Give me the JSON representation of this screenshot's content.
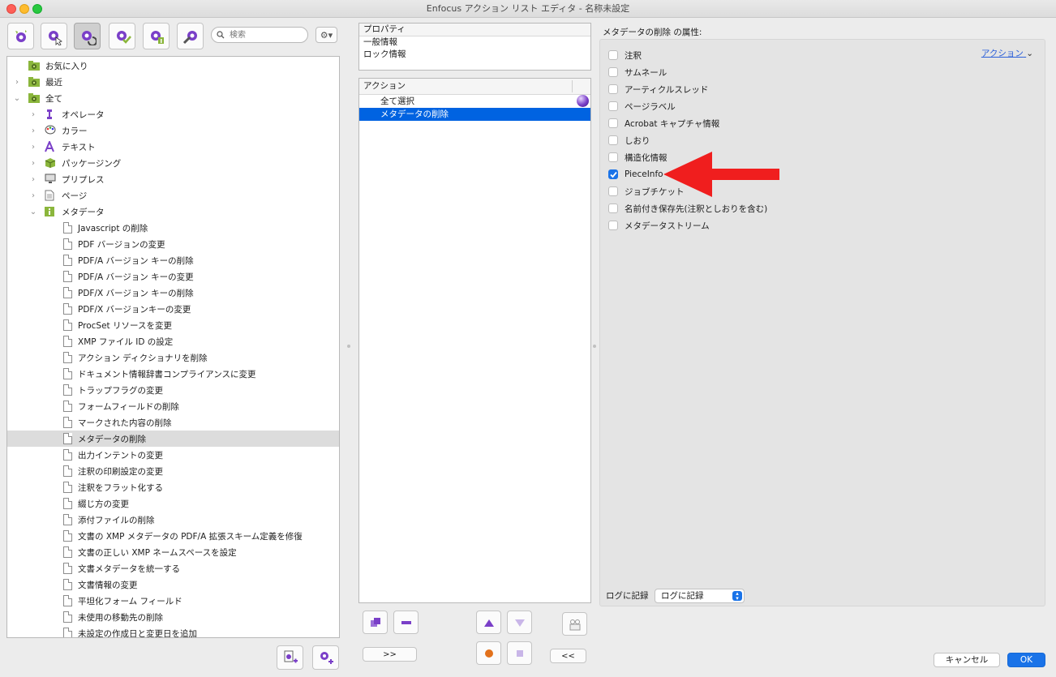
{
  "window": {
    "title": "Enfocus アクション リスト エディタ - 名称未設定"
  },
  "toolbar": {
    "buttons": [
      {
        "icon": "gear-sparkle-icon"
      },
      {
        "icon": "gear-cursor-icon"
      },
      {
        "icon": "gear-refresh-icon"
      },
      {
        "icon": "gear-check-icon"
      },
      {
        "icon": "gear-info-icon"
      },
      {
        "icon": "wrench-gear-icon"
      }
    ],
    "search_placeholder": "検索",
    "options_label": "⚙▾"
  },
  "tree": {
    "categories": [
      {
        "label": "お気に入り",
        "expanded": false,
        "level": 0,
        "icon": "folder-gear-icon"
      },
      {
        "label": "最近",
        "expanded": false,
        "level": 0,
        "icon": "folder-gear-icon"
      },
      {
        "label": "全て",
        "expanded": true,
        "level": 0,
        "icon": "folder-gear-icon"
      },
      {
        "label": "オペレータ",
        "expanded": false,
        "level": 1,
        "icon": "operator-icon"
      },
      {
        "label": "カラー",
        "expanded": false,
        "level": 1,
        "icon": "palette-icon"
      },
      {
        "label": "テキスト",
        "expanded": false,
        "level": 1,
        "icon": "text-icon"
      },
      {
        "label": "パッケージング",
        "expanded": false,
        "level": 1,
        "icon": "package-icon"
      },
      {
        "label": "プリプレス",
        "expanded": false,
        "level": 1,
        "icon": "monitor-icon"
      },
      {
        "label": "ページ",
        "expanded": false,
        "level": 1,
        "icon": "page-icon"
      },
      {
        "label": "メタデータ",
        "expanded": true,
        "level": 1,
        "icon": "info-icon"
      }
    ],
    "metadata_items": [
      "Javascript の削除",
      "PDF バージョンの変更",
      "PDF/A バージョン キーの削除",
      "PDF/A バージョン キーの変更",
      "PDF/X バージョン キーの削除",
      "PDF/X バージョンキーの変更",
      "ProcSet リソースを変更",
      "XMP ファイル ID の設定",
      "アクション ディクショナリを削除",
      "ドキュメント情報辞書コンプライアンスに変更",
      "トラップフラグの変更",
      "フォームフィールドの削除",
      "マークされた内容の削除",
      "メタデータの削除",
      "出力インテントの変更",
      "注釈の印刷設定の変更",
      "注釈をフラット化する",
      "綴じ方の変更",
      "添付ファイルの削除",
      "文書の XMP メタデータの PDF/A 拡張スキーム定義を修復",
      "文書の正しい XMP ネームスペースを設定",
      "文書メタデータを統一する",
      "文書情報の変更",
      "平坦化フォーム フィールド",
      "未使用の移動先の削除",
      "未設定の作成日と変更日を追加"
    ],
    "selected_item": "メタデータの削除"
  },
  "left_bottom_buttons": [
    {
      "icon": "page-add-icon"
    },
    {
      "icon": "gear-add-icon"
    }
  ],
  "properties": {
    "header": "プロパティ",
    "items": [
      "一般情報",
      "ロック情報"
    ]
  },
  "actions": {
    "header": "アクション",
    "rows": [
      {
        "label": "全て選択",
        "selected": false
      },
      {
        "label": "メタデータの削除",
        "selected": true
      }
    ]
  },
  "middle_buttons": {
    "add_label": ">>",
    "remove_label": "<<"
  },
  "attributes": {
    "title": "メタデータの削除 の属性:",
    "action_link": "アクション",
    "options": [
      {
        "label": "注釈",
        "checked": false
      },
      {
        "label": "サムネール",
        "checked": false
      },
      {
        "label": "アーティクルスレッド",
        "checked": false
      },
      {
        "label": "ページラベル",
        "checked": false
      },
      {
        "label": "Acrobat キャプチャ情報",
        "checked": false
      },
      {
        "label": "しおり",
        "checked": false
      },
      {
        "label": "構造化情報",
        "checked": false
      },
      {
        "label": "PieceInfo",
        "checked": true
      },
      {
        "label": "ジョブチケット",
        "checked": false
      },
      {
        "label": "名前付き保存先(注釈としおりを含む)",
        "checked": false
      },
      {
        "label": "メタデータストリーム",
        "checked": false
      }
    ],
    "log_label": "ログに記録",
    "log_value": "ログに記録"
  },
  "dialog": {
    "cancel_label": "キャンセル",
    "ok_label": "OK"
  },
  "colors": {
    "accent": "#1a73e8",
    "selection": "#0063e1",
    "annotation_arrow": "#f01e1e",
    "icon_purple": "#7a3fc8",
    "icon_green": "#8bb63c"
  }
}
